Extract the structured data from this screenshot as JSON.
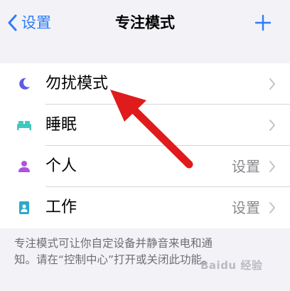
{
  "navbar": {
    "back_label": "设置",
    "title": "专注模式"
  },
  "rows": [
    {
      "label": "勿扰模式",
      "value": "",
      "icon": "moon-icon",
      "icon_color": "#5e5ce6"
    },
    {
      "label": "睡眠",
      "value": "",
      "icon": "bed-icon",
      "icon_color": "#40c8c0"
    },
    {
      "label": "个人",
      "value": "设置",
      "icon": "person-icon",
      "icon_color": "#af52de"
    },
    {
      "label": "工作",
      "value": "设置",
      "icon": "id-badge-icon",
      "icon_color": "#30a7c8"
    }
  ],
  "footer": {
    "line1": "专注模式可让你自定设备并静音来电和通",
    "line2": "知。请在“控制中心”打开或关闭此功能。"
  },
  "watermark": "Baidu 经验",
  "colors": {
    "accent": "#2f7cf6",
    "annotation_arrow": "#e01b1b",
    "background": "#f2f2f7"
  }
}
